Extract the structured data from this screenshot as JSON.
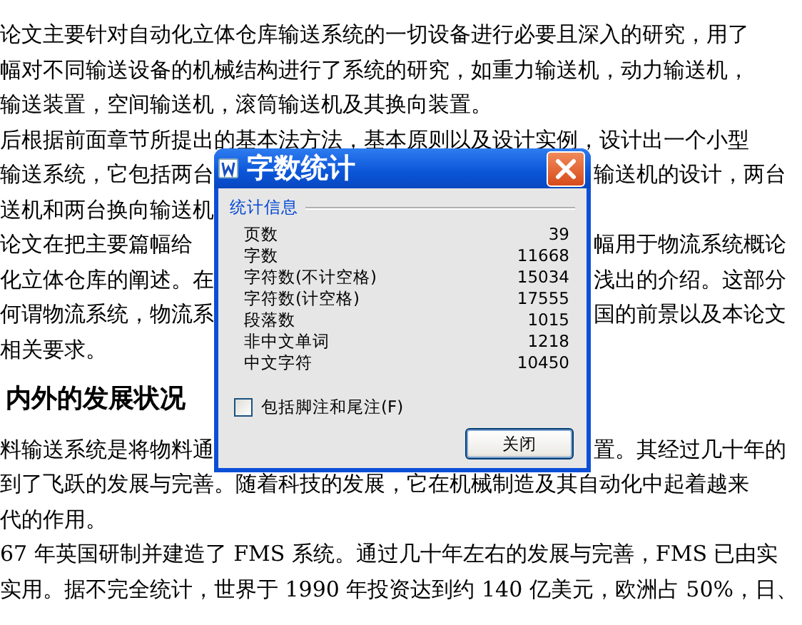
{
  "document": {
    "lines": [
      {
        "kind": "text",
        "text": "论文主要针对自动化立体仓库输送系统的一切设备进行必要且深入的研究，用了"
      },
      {
        "kind": "text",
        "text": "幅对不同输送设备的机械结构进行了系统的研究，如重力输送机，动力输送机，"
      },
      {
        "kind": "text",
        "text": "输送装置，空间输送机，滚筒输送机及其换向装置。"
      },
      {
        "kind": "text",
        "text": "后根据前面章节所提出的基本法方法，基本原则以及设计实例，设计出一个小型"
      },
      {
        "kind": "split",
        "left": "输送系统，它包括两台",
        "right": "输送机的设计，两台"
      },
      {
        "kind": "split",
        "left": "送机和两台换向输送机"
      },
      {
        "kind": "split",
        "left": "论文在把主要篇幅给",
        "right": "幅用于物流系统概论"
      },
      {
        "kind": "split",
        "left": "化立体仓库的阐述。在",
        "right": "浅出的介绍。这部分"
      },
      {
        "kind": "split",
        "left": "何谓物流系统，物流系",
        "right": "国的前景以及本论文"
      },
      {
        "kind": "text",
        "text": "相关要求。"
      },
      {
        "kind": "heading",
        "text": "内外的发展状况"
      },
      {
        "kind": "split",
        "left": "料输送系统是将物料通",
        "right": "置。其经过几十年的"
      },
      {
        "kind": "text",
        "text": "到了飞跃的发展与完善。随着科技的发展，它在机械制造及其自动化中起着越来"
      },
      {
        "kind": "text",
        "text": "代的作用。"
      },
      {
        "kind": "text",
        "text": "67 年英国研制并建造了 FMS 系统。通过几十年左右的发展与完善，FMS 已由实"
      },
      {
        "kind": "text",
        "text": "实用。据不完全统计，世界于 1990 年投资达到约 140 亿美元，欧洲占 50%，日、"
      }
    ]
  },
  "dialog": {
    "title": "字数统计",
    "group": "统计信息",
    "stats": [
      {
        "label": "页数",
        "value": "39"
      },
      {
        "label": "字数",
        "value": "11668"
      },
      {
        "label": "字符数(不计空格)",
        "value": "15034"
      },
      {
        "label": "字符数(计空格)",
        "value": "17555"
      },
      {
        "label": "段落数",
        "value": "1015"
      },
      {
        "label": "非中文单词",
        "value": "1218"
      },
      {
        "label": "中文字符",
        "value": "10450"
      }
    ],
    "checkbox": {
      "label": "包括脚注和尾注(F)",
      "checked": false
    },
    "buttons": [
      "关闭"
    ]
  }
}
